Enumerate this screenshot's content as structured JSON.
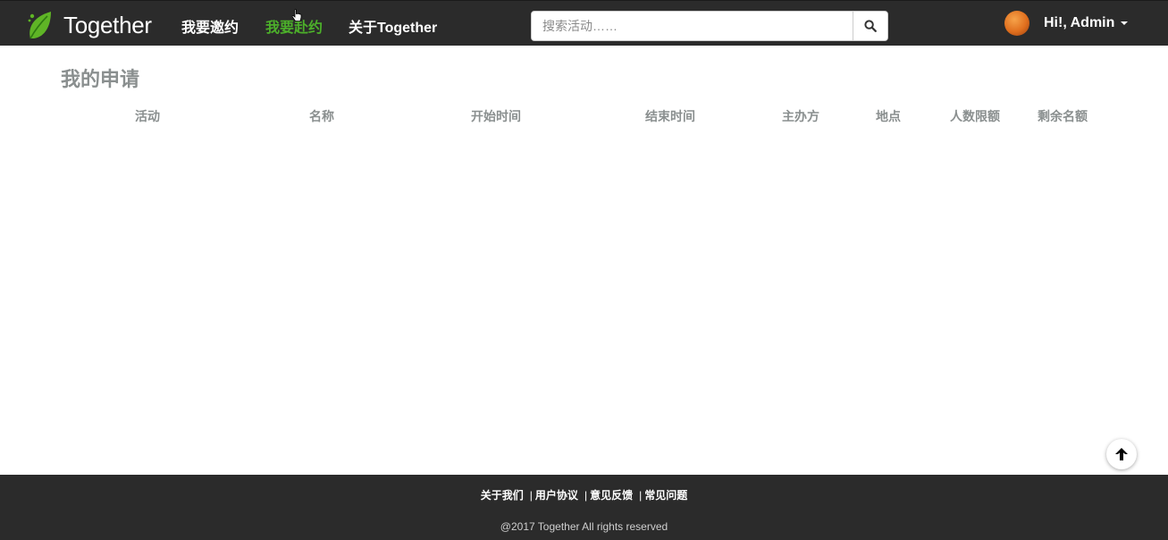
{
  "navbar": {
    "brand": "Together",
    "links": [
      {
        "label": "我要邀约",
        "active": false
      },
      {
        "label": "我要赴约",
        "active": true
      },
      {
        "label": "关于Together",
        "active": false
      }
    ],
    "search_placeholder": "搜索活动……",
    "user_greeting": "Hi!, Admin"
  },
  "main": {
    "title": "我的申请",
    "columns": [
      "活动",
      "名称",
      "开始时间",
      "结束时间",
      "主办方",
      "地点",
      "人数限额",
      "剩余名额"
    ],
    "rows": []
  },
  "footer": {
    "links": [
      "关于我们",
      "用户协议",
      "意见反馈",
      "常见问题"
    ],
    "separator": "|",
    "copyright": "@2017 Together All rights reserved"
  },
  "colors": {
    "navbar_bg": "#2b2b2b",
    "accent_green": "#4caf2a",
    "muted_text": "#8a8f8f"
  },
  "icons": [
    "leaf-logo-icon",
    "search-icon",
    "caret-down-icon",
    "arrow-up-icon",
    "pointer-cursor-icon"
  ]
}
